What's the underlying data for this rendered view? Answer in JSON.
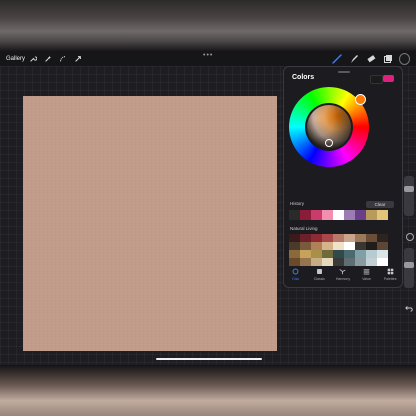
{
  "toolbar": {
    "gallery_label": "Gallery",
    "more_dots": "•••",
    "left_tools": [
      "wrench-icon",
      "magic-wand-icon",
      "selection-icon",
      "transform-arrow-icon"
    ],
    "right_tools": [
      "brush-icon",
      "smudge-icon",
      "eraser-icon",
      "layers-icon",
      "color-swatch-icon"
    ]
  },
  "colors_panel": {
    "title": "Colors",
    "primary_color": "#e0207f",
    "secondary_color": "#1b1b1b",
    "wheel_hue_color": "#ff7a00",
    "history_label": "History",
    "clear_label": "Clear",
    "history_swatches": [
      "#2a2a2a",
      "#8a1c3a",
      "#c93b6a",
      "#f28fb0",
      "#ffffff",
      "#9d7cb5",
      "#6a3f8a",
      "#b89a5a",
      "#e2c47a"
    ],
    "palette_label": "Natural Living",
    "palette_rows": [
      [
        "#3b1a1a",
        "#6e1f2a",
        "#8e2a32",
        "#a8484a",
        "#b77a6a",
        "#caa38b",
        "#9a7a5a",
        "#6b4e38",
        "#2c2420"
      ],
      [
        "#4a3a2c",
        "#7a5a3c",
        "#b08058",
        "#d6b48a",
        "#f0e2c8",
        "#ffffff",
        "#3b3631",
        "#1f1c1a",
        "#5d4636"
      ],
      [
        "#8a6a3a",
        "#c7a25a",
        "#a8904a",
        "#6f6a3a",
        "#2f4a4a",
        "#4a6a6f",
        "#7fa0a6",
        "#b6ccd0",
        "#d8e4e6"
      ],
      [
        "#6a4a2a",
        "#94754f",
        "#c6ad86",
        "#e6d8bc",
        "#3a3a3a",
        "#5f6e72",
        "#8a9aa0",
        "#c2d0d4",
        "#ffffff"
      ]
    ],
    "tabs": [
      {
        "label": "Disc",
        "icon": "disc-icon",
        "active": true
      },
      {
        "label": "Classic",
        "icon": "classic-icon",
        "active": false
      },
      {
        "label": "Harmony",
        "icon": "harmony-icon",
        "active": false
      },
      {
        "label": "Value",
        "icon": "value-icon",
        "active": false
      },
      {
        "label": "Palettes",
        "icon": "palettes-icon",
        "active": false
      }
    ]
  },
  "canvas": {
    "fill_color": "#c29c8a"
  }
}
